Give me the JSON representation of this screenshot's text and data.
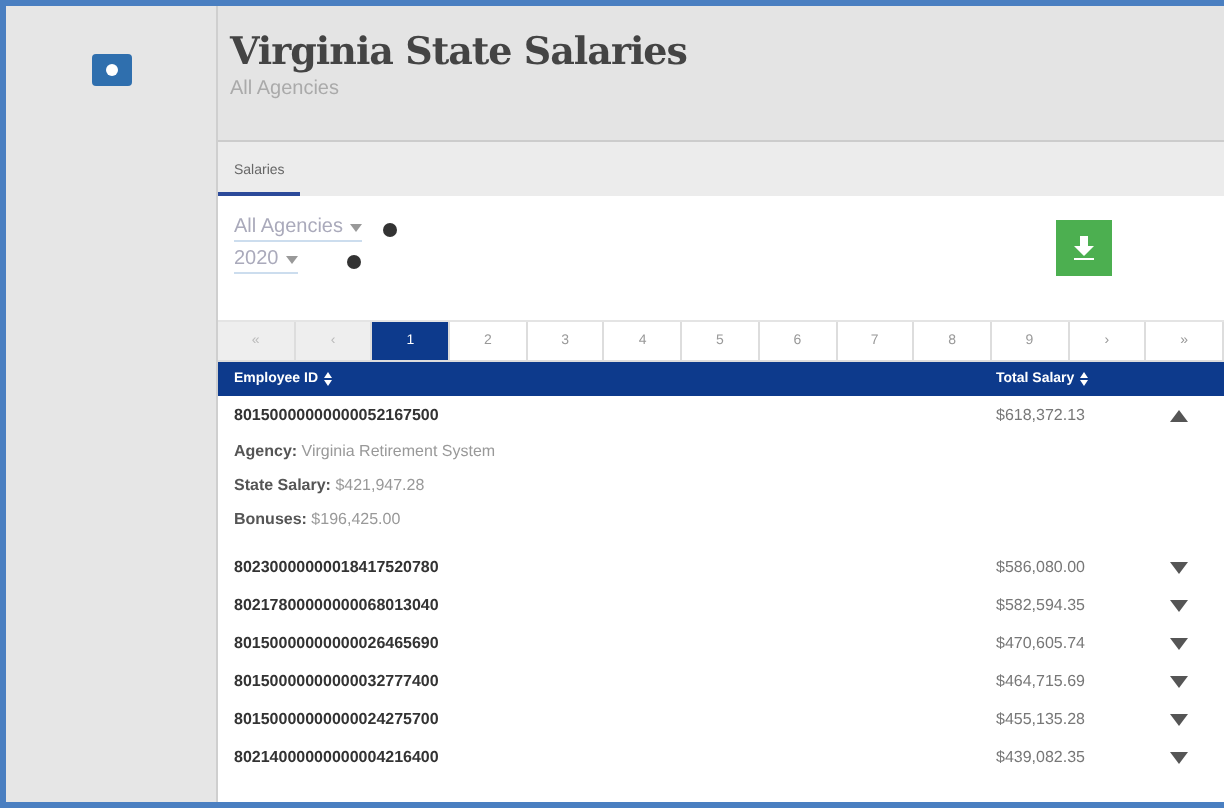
{
  "header": {
    "title": "Virginia State Salaries",
    "subtitle": "All Agencies"
  },
  "tabs": [
    {
      "label": "Salaries",
      "selected": true
    }
  ],
  "filters": [
    {
      "value": "All Agencies"
    },
    {
      "value": "2020"
    }
  ],
  "pagination": [
    {
      "label": "«",
      "selected": false,
      "disabled": true
    },
    {
      "label": "‹",
      "selected": false,
      "disabled": true
    },
    {
      "label": "1",
      "selected": true,
      "disabled": false
    },
    {
      "label": "2",
      "selected": false,
      "disabled": false
    },
    {
      "label": "3",
      "selected": false,
      "disabled": false
    },
    {
      "label": "4",
      "selected": false,
      "disabled": false
    },
    {
      "label": "5",
      "selected": false,
      "disabled": false
    },
    {
      "label": "6",
      "selected": false,
      "disabled": false
    },
    {
      "label": "7",
      "selected": false,
      "disabled": false
    },
    {
      "label": "8",
      "selected": false,
      "disabled": false
    },
    {
      "label": "9",
      "selected": false,
      "disabled": false
    },
    {
      "label": "›",
      "selected": false,
      "disabled": false
    },
    {
      "label": "»",
      "selected": false,
      "disabled": false
    }
  ],
  "table": {
    "columns": [
      "Employee ID",
      "Total Salary"
    ],
    "rows": [
      {
        "id": "80150000000000052167500",
        "total": "$618,372.13",
        "expanded": true,
        "details": [
          {
            "label": "Agency:",
            "value": "Virginia Retirement System"
          },
          {
            "label": "State Salary:",
            "value": "$421,947.28"
          },
          {
            "label": "Bonuses:",
            "value": "$196,425.00"
          }
        ]
      },
      {
        "id": "80230000000018417520780",
        "total": "$586,080.00",
        "expanded": false
      },
      {
        "id": "80217800000000068013040",
        "total": "$582,594.35",
        "expanded": false
      },
      {
        "id": "80150000000000026465690",
        "total": "$470,605.74",
        "expanded": false
      },
      {
        "id": "80150000000000032777400",
        "total": "$464,715.69",
        "expanded": false
      },
      {
        "id": "80150000000000024275700",
        "total": "$455,135.28",
        "expanded": false
      },
      {
        "id": "80214000000000004216400",
        "total": "$439,082.35",
        "expanded": false
      }
    ]
  }
}
